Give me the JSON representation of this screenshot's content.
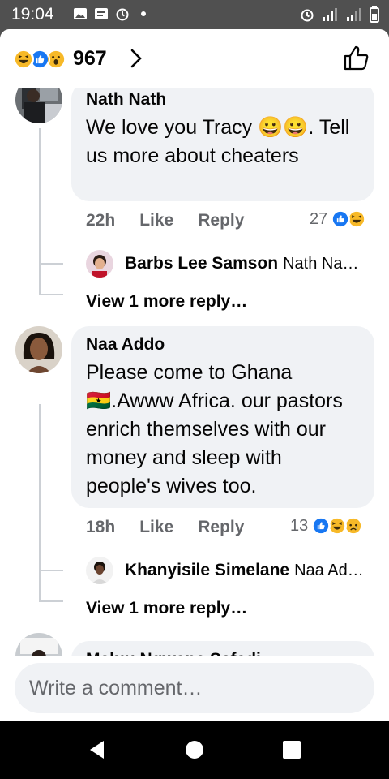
{
  "status_bar": {
    "time": "19:04"
  },
  "header": {
    "reaction_count": "967"
  },
  "comments": [
    {
      "author": "Nath Nath",
      "text": "We love you Tracy 😀😀. Tell us more about cheaters",
      "time": "22h",
      "like_label": "Like",
      "reply_label": "Reply",
      "reaction_count": "27",
      "replies": [
        {
          "author": "Barbs Lee Samson",
          "preview": "Nath Na…"
        }
      ],
      "more_replies": "View 1 more reply…"
    },
    {
      "author": "Naa Addo",
      "text": "Please come to Ghana 🇬🇭.Awww Africa. our pastors enrich themselves with our money and sleep with people's wives too.",
      "time": "18h",
      "like_label": "Like",
      "reply_label": "Reply",
      "reaction_count": "13",
      "replies": [
        {
          "author": "Khanyisile Simelane",
          "preview": "Naa Ad…"
        }
      ],
      "more_replies": "View 1 more reply…"
    },
    {
      "author": "Maluu Ngwana Sefadi"
    }
  ],
  "composer": {
    "placeholder": "Write a comment…"
  },
  "colors": {
    "like_blue": "#1877f2",
    "haha_yellow": "#f7b928",
    "text_gray": "#65676b",
    "bubble_gray": "#f0f2f5"
  },
  "icons": [
    "haha-icon",
    "like-icon",
    "wow-icon",
    "sad-icon",
    "chevron-right-icon",
    "thumbs-up-icon",
    "back-icon",
    "home-icon",
    "recents-icon"
  ]
}
